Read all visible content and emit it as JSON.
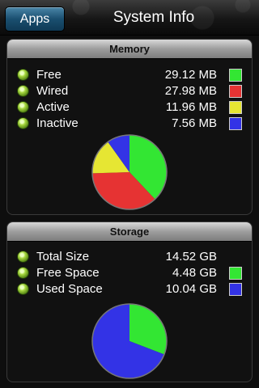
{
  "nav": {
    "back_label": "Apps",
    "title": "System Info"
  },
  "memory": {
    "header": "Memory",
    "rows": [
      {
        "label": "Free",
        "value": "29.12 MB",
        "color": "#33e633"
      },
      {
        "label": "Wired",
        "value": "27.98 MB",
        "color": "#e63333"
      },
      {
        "label": "Active",
        "value": "11.96 MB",
        "color": "#e6e633"
      },
      {
        "label": "Inactive",
        "value": "7.56 MB",
        "color": "#3333e6"
      }
    ]
  },
  "storage": {
    "header": "Storage",
    "rows": [
      {
        "label": "Total Size",
        "value": "14.52 GB",
        "color": null
      },
      {
        "label": "Free Space",
        "value": "4.48 GB",
        "color": "#33e633"
      },
      {
        "label": "Used Space",
        "value": "10.04 GB",
        "color": "#3333e6"
      }
    ]
  },
  "chart_data": [
    {
      "type": "pie",
      "categories": [
        "Free",
        "Wired",
        "Active",
        "Inactive"
      ],
      "values": [
        29.12,
        27.98,
        11.96,
        7.56
      ],
      "colors": [
        "#33e633",
        "#e63333",
        "#e6e633",
        "#3333e6"
      ]
    },
    {
      "type": "pie",
      "categories": [
        "Free Space",
        "Used Space"
      ],
      "values": [
        4.48,
        10.04
      ],
      "colors": [
        "#33e633",
        "#3333e6"
      ]
    }
  ]
}
